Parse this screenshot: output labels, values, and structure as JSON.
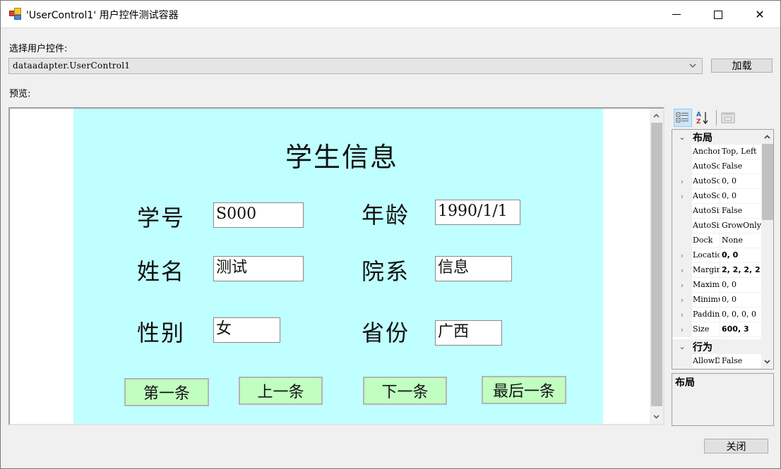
{
  "window": {
    "title": "'UserControl1' 用户控件测试容器",
    "icon": "app-form-icon",
    "controls": {
      "minimize": "minimize-icon",
      "maximize": "maximize-icon",
      "close": "✕"
    }
  },
  "selector": {
    "label": "选择用户控件:",
    "selected_value": "dataadapter.UserControl1",
    "load_button": "加载"
  },
  "preview": {
    "label": "预览:",
    "user_control": {
      "title": "学生信息",
      "background": "#c0ffff",
      "fields": [
        {
          "label": "学号",
          "value": "S000"
        },
        {
          "label": "年龄",
          "value": "1990/1/1"
        },
        {
          "label": "姓名",
          "value": "测试"
        },
        {
          "label": "院系",
          "value": "信息"
        },
        {
          "label": "性别",
          "value": "女"
        },
        {
          "label": "省份",
          "value": "广西"
        }
      ],
      "nav_buttons": [
        "第一条",
        "上一条",
        "下一条",
        "最后一条"
      ],
      "nav_button_color": "#c0ffc0"
    }
  },
  "property_grid": {
    "toolbar": [
      "categorized-icon",
      "alphabetical-icon",
      "property-pages-icon"
    ],
    "categories": [
      {
        "name": "布局",
        "expanded": true,
        "properties": [
          {
            "name": "Anchor",
            "value": "Top, Left",
            "expandable": false,
            "bold": false
          },
          {
            "name": "AutoScroll",
            "value": "False",
            "expandable": false,
            "bold": false
          },
          {
            "name": "AutoScrollMargin",
            "value": "0, 0",
            "expandable": true,
            "bold": false
          },
          {
            "name": "AutoScrollMinSize",
            "value": "0, 0",
            "expandable": true,
            "bold": false
          },
          {
            "name": "AutoSize",
            "value": "False",
            "expandable": false,
            "bold": false
          },
          {
            "name": "AutoSizeMode",
            "value": "GrowOnly",
            "expandable": false,
            "bold": false
          },
          {
            "name": "Dock",
            "value": "None",
            "expandable": false,
            "bold": false
          },
          {
            "name": "Location",
            "value": "0, 0",
            "expandable": true,
            "bold": true
          },
          {
            "name": "Margin",
            "value": "2, 2, 2, 2",
            "expandable": true,
            "bold": true
          },
          {
            "name": "MaximumSize",
            "value": "0, 0",
            "expandable": true,
            "bold": false
          },
          {
            "name": "MinimumSize",
            "value": "0, 0",
            "expandable": true,
            "bold": false
          },
          {
            "name": "Padding",
            "value": "0, 0, 0, 0",
            "expandable": true,
            "bold": false
          },
          {
            "name": "Size",
            "value": "600, 3",
            "expandable": true,
            "bold": true
          }
        ]
      },
      {
        "name": "行为",
        "expanded": true,
        "properties": [
          {
            "name": "AllowDrop",
            "value": "False",
            "expandable": false,
            "bold": false
          }
        ]
      }
    ],
    "description_title": "布局"
  },
  "footer": {
    "close_button": "关闭"
  }
}
